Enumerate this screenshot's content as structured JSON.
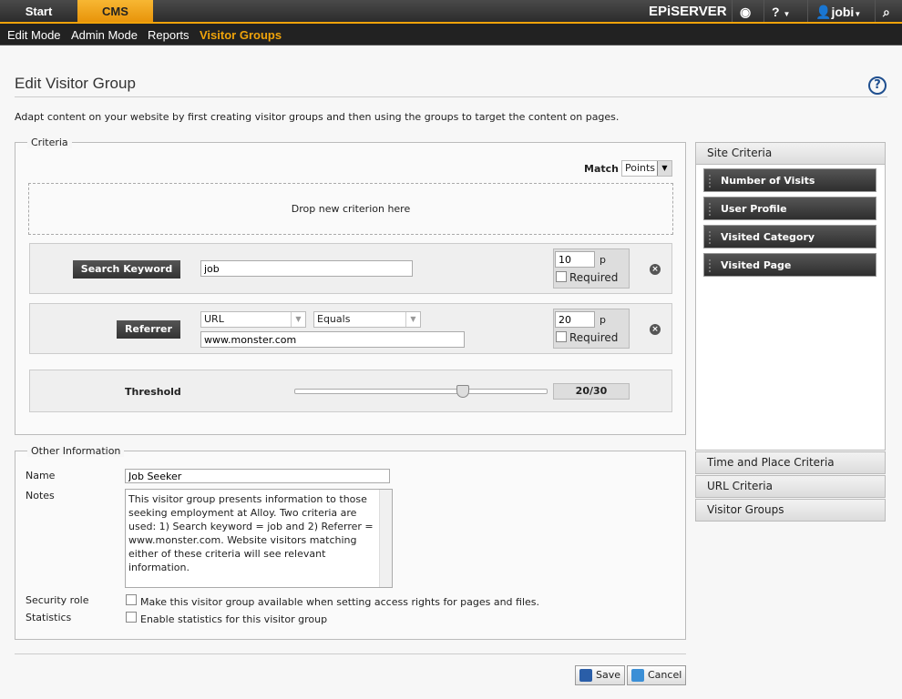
{
  "topbar": {
    "tabs": [
      "Start",
      "CMS"
    ],
    "brand": "EPiSERVER",
    "help": "?",
    "user": "jobi"
  },
  "subnav": [
    "Edit Mode",
    "Admin Mode",
    "Reports",
    "Visitor Groups"
  ],
  "page": {
    "title": "Edit Visitor Group",
    "intro": "Adapt content on your website by first creating visitor groups and then using the groups to target the content on pages."
  },
  "criteria": {
    "legend": "Criteria",
    "match_label": "Match",
    "match_value": "Points",
    "drop_hint": "Drop new criterion here",
    "search": {
      "label": "Search Keyword",
      "value": "job",
      "points": "10",
      "unit": "p",
      "required": "Required"
    },
    "referrer": {
      "label": "Referrer",
      "type": "URL",
      "operator": "Equals",
      "value": "www.monster.com",
      "points": "20",
      "unit": "p",
      "required": "Required"
    },
    "threshold": {
      "label": "Threshold",
      "value": 20,
      "max": 30,
      "display": "20/30"
    }
  },
  "other": {
    "legend": "Other Information",
    "name_label": "Name",
    "name_value": "Job Seeker",
    "notes_label": "Notes",
    "notes_value": "This visitor group presents information to those seeking employment at Alloy. Two criteria are used: 1) Search keyword = job and 2) Referrer = www.monster.com. Website visitors matching either of these criteria will see relevant information.",
    "security_label": "Security role",
    "security_text": "Make this visitor group available when setting access rights for pages and files.",
    "stats_label": "Statistics",
    "stats_text": "Enable statistics for this visitor group"
  },
  "sidebar": {
    "site_criteria": "Site Criteria",
    "items": [
      "Number of Visits",
      "User Profile",
      "Visited Category",
      "Visited Page"
    ],
    "sections": [
      "Time and Place Criteria",
      "URL Criteria",
      "Visitor Groups"
    ]
  },
  "buttons": {
    "save": "Save",
    "cancel": "Cancel"
  }
}
